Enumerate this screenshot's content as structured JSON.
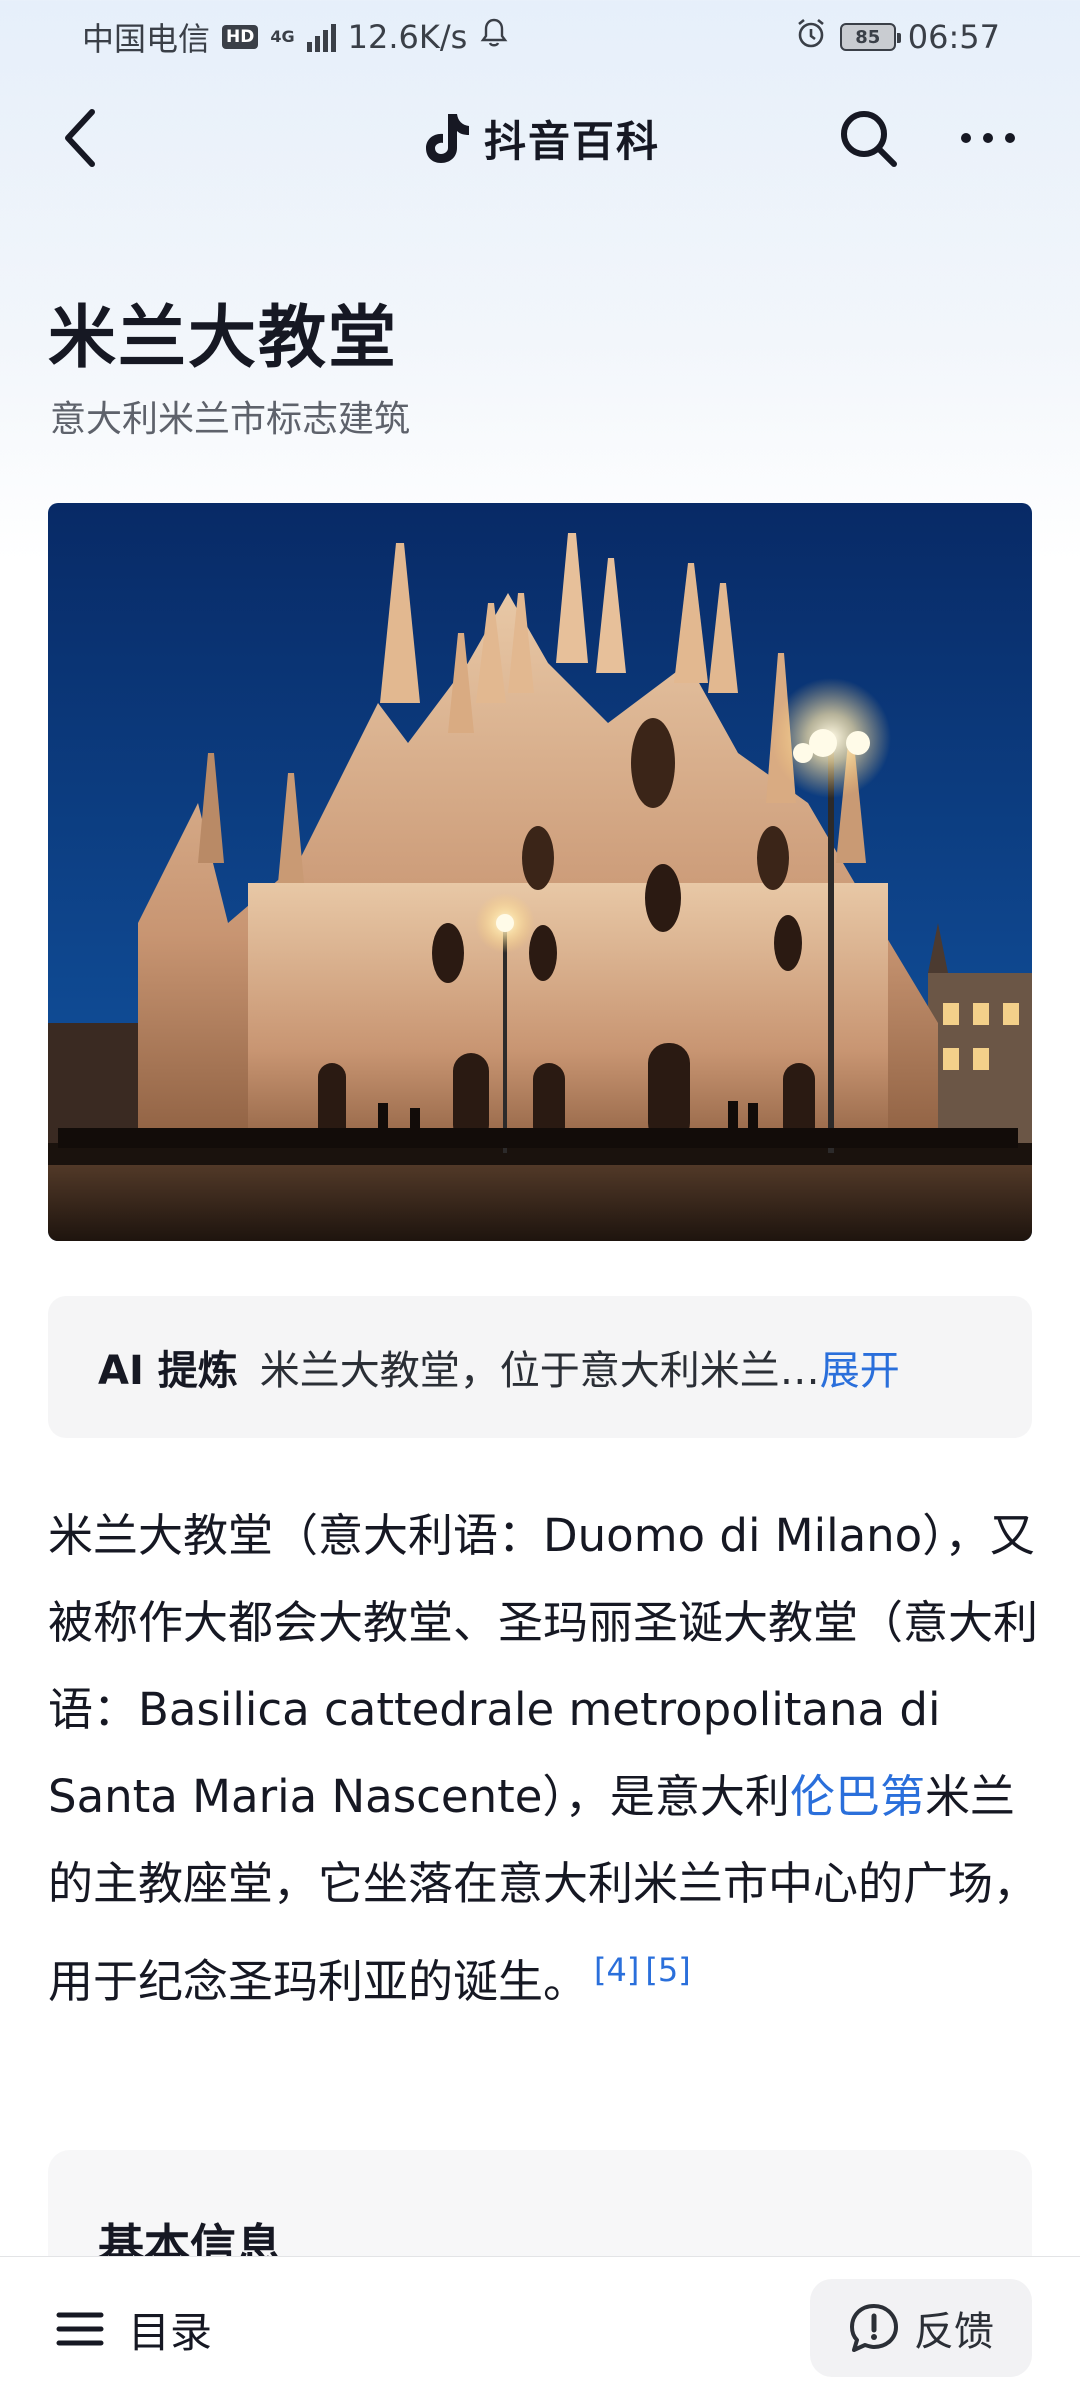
{
  "status_bar": {
    "carrier": "中国电信",
    "hd_badge": "HD",
    "network_type": "4G",
    "speed": "12.6K/s",
    "battery": "85",
    "time": "06:57"
  },
  "header": {
    "brand_title": "抖音百科",
    "icons": [
      "back-chevron-icon",
      "tiktok-logo-icon",
      "search-icon",
      "more-icon"
    ]
  },
  "article": {
    "title": "米兰大教堂",
    "subtitle": "意大利米兰市标志建筑",
    "hero_alt": "Milan Cathedral at dusk"
  },
  "ai_summary": {
    "label": "AI 提炼",
    "text": "米兰大教堂，位于意大利米兰…",
    "expand": "展开"
  },
  "intro": {
    "part1": "米兰大教堂（意大利语：Duomo di Milano），又被称作大都会大教堂、圣玛丽圣诞大教堂（意大利语：Basilica cattedrale metropolitana di Santa Maria Nascente），是意大利",
    "link": "伦巴第",
    "part2": "米兰的主教座堂，它坐落在意大利米兰市中心的广场，用于纪念圣玛利亚的诞生。",
    "ref1": "[4]",
    "ref2": "[5]"
  },
  "info_card": {
    "title": "基本信息"
  },
  "bottom_bar": {
    "toc_label": "目录",
    "feedback_label": "反馈"
  },
  "colors": {
    "link": "#2a6fdb",
    "text": "#161823",
    "sky": "#0d3a78"
  }
}
